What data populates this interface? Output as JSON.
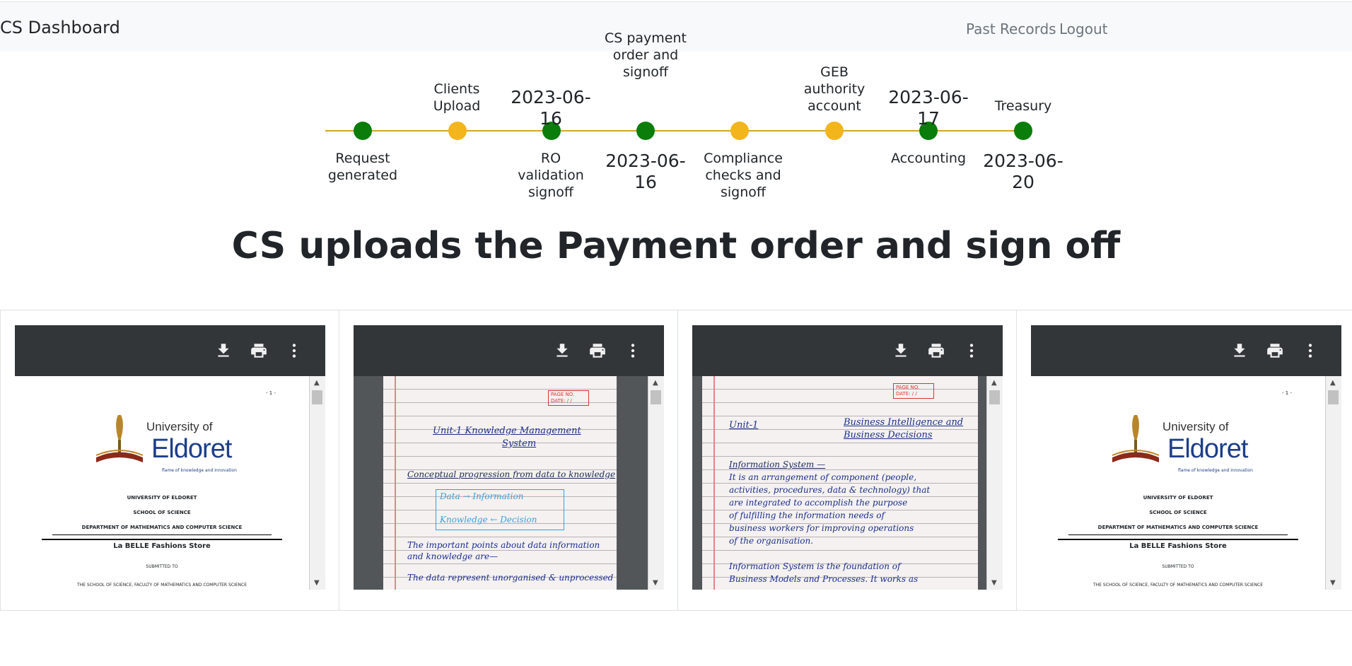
{
  "navbar": {
    "brand": "CS Dashboard",
    "links": [
      "Past Records",
      "Logout"
    ]
  },
  "timeline": {
    "steps": [
      {
        "label": "Request generated",
        "status": "complete",
        "date": ""
      },
      {
        "label": "Clients Upload",
        "status": "pending",
        "date": ""
      },
      {
        "label": "RO validation signoff",
        "status": "complete",
        "date": "2023-06-16"
      },
      {
        "label": "CS payment order and signoff",
        "status": "complete",
        "date": "2023-06-16"
      },
      {
        "label": "Compliance checks and signoff",
        "status": "pending",
        "date": ""
      },
      {
        "label": "GEB authority account",
        "status": "pending",
        "date": ""
      },
      {
        "label": "Accounting",
        "status": "complete",
        "date": "2023-06-17"
      },
      {
        "label": "Treasury",
        "status": "complete",
        "date": "2023-06-20"
      }
    ],
    "colors": {
      "complete": "#0a7d0a",
      "pending": "#f2b51c",
      "line": "#d4a32a"
    }
  },
  "heading": "CS uploads the Payment order and sign off",
  "documents": [
    {
      "type": "pdf",
      "page_marker": "- 1 -",
      "logo_line1": "University of",
      "logo_line2": "Eldoret",
      "logo_tagline": "flame of knowledge and innovation",
      "lines": [
        "UNIVERSITY OF ELDORET",
        "SCHOOL OF SCIENCE",
        "DEPARTMENT OF MATHEMATICS AND COMPUTER SCIENCE"
      ],
      "title": "La BELLE Fashions Store",
      "submitted": "SUBMITTED TO",
      "footer": "THE SCHOOL OF SCIENCE, FACULTY OF MATHEMATICS AND COMPUTER SCIENCE"
    },
    {
      "type": "notes",
      "stamp": "PAGE NO. DATE: / /",
      "lines": [
        "Unit-1  Knowledge Management",
        "System",
        "Conceptual progression from data to knowledge",
        "Data → Information",
        "Knowledge ← Decision",
        "The important points about data information",
        "and knowledge are—",
        "The data represent unorganised & unprocessed"
      ]
    },
    {
      "type": "notes",
      "stamp": "PAGE NO. DATE: / /",
      "lines": [
        "Unit-1",
        "Business Intelligence and",
        "Business Decisions",
        "Information System —",
        "It is an arrangement of component (people,",
        "activities, procedures, data & technology) that",
        "are integrated to accomplish the purpose",
        "of fulfilling the information needs of",
        "business workers for improving operations",
        "of the organisation.",
        "Information System is the foundation of",
        "Business Models and Processes. It works as"
      ]
    },
    {
      "type": "pdf",
      "page_marker": "- 1 -",
      "logo_line1": "University of",
      "logo_line2": "Eldoret",
      "logo_tagline": "flame of knowledge and innovation",
      "lines": [
        "UNIVERSITY OF ELDORET",
        "SCHOOL OF SCIENCE",
        "DEPARTMENT OF MATHEMATICS AND COMPUTER SCIENCE"
      ],
      "title": "La BELLE Fashions Store",
      "submitted": "SUBMITTED TO",
      "footer": "THE SCHOOL OF SCIENCE, FACULTY OF MATHEMATICS AND COMPUTER SCIENCE"
    }
  ],
  "viewer_icons": [
    "download-icon",
    "print-icon",
    "more-vert-icon"
  ]
}
